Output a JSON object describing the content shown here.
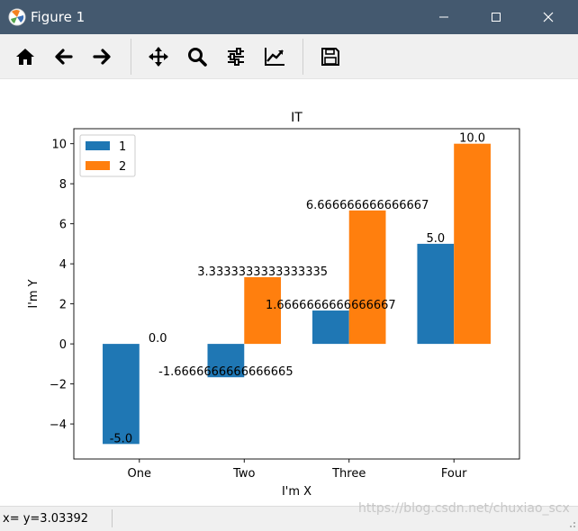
{
  "window": {
    "title": "Figure 1"
  },
  "toolbar": {
    "icons": [
      "home-icon",
      "back-arrow-icon",
      "forward-arrow-icon",
      "pan-icon",
      "zoom-icon",
      "subplots-icon",
      "edit-axis-icon",
      "save-icon"
    ]
  },
  "status": {
    "text": "x= y=3.03392"
  },
  "watermark": "https://blog.csdn.net/chuxiao_scx",
  "colors": {
    "series1": "#1f77b4",
    "series2": "#ff7f0e",
    "titlebar": "#44596f"
  },
  "chart_data": {
    "type": "bar",
    "title": "IT",
    "xlabel": "I'm X",
    "ylabel": "I'm Y",
    "categories": [
      "One",
      "Two",
      "Three",
      "Four"
    ],
    "series": [
      {
        "name": "1",
        "values": [
          -5.0,
          -1.6666666666666665,
          1.6666666666666667,
          5.0
        ],
        "labels": [
          "-5.0",
          "-1.6666666666666665",
          "1.6666666666666667",
          "5.0"
        ]
      },
      {
        "name": "2",
        "values": [
          0.0,
          3.3333333333333335,
          6.666666666666667,
          10.0
        ],
        "labels": [
          "0.0",
          "3.3333333333333335",
          "6.666666666666667",
          "10.0"
        ]
      }
    ],
    "ylim": [
      -5.75,
      10.75
    ],
    "yticks": [
      -4,
      -2,
      0,
      2,
      4,
      6,
      8,
      10
    ],
    "ytick_labels": [
      "−4",
      "−2",
      "0",
      "2",
      "4",
      "6",
      "8",
      "10"
    ],
    "grid": false,
    "legend": "upper-left"
  }
}
